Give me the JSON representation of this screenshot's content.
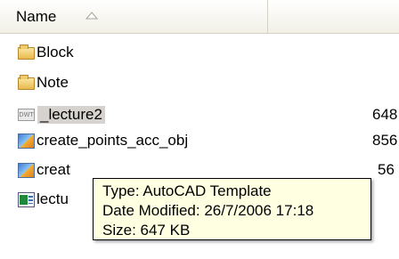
{
  "header": {
    "name_label": "Name",
    "sort_icon": "sort-ascending-icon"
  },
  "files": [
    {
      "name": "Block",
      "icon": "folder-icon",
      "size": "",
      "selected": false
    },
    {
      "name": "Note",
      "icon": "folder-icon",
      "size": "",
      "selected": false
    },
    {
      "name": "_lecture2",
      "icon": "dwt-file-icon",
      "size": "648",
      "selected": true
    },
    {
      "name": "create_points_acc_obj",
      "icon": "obj-file-icon",
      "size": "856",
      "selected": false
    },
    {
      "name": "creat",
      "icon": "obj-file-icon",
      "size": "56",
      "selected": false
    },
    {
      "name": "lectu",
      "icon": "excel-file-icon",
      "size": "",
      "selected": false
    }
  ],
  "tooltip": {
    "type": "Type: AutoCAD Template",
    "modified": "Date Modified: 26/7/2006 17:18",
    "size": "Size: 647 KB"
  },
  "colors": {
    "tooltip_bg": "#ffffe1",
    "selection": "#d6d3ce",
    "header_bg": "#f1efe6"
  }
}
